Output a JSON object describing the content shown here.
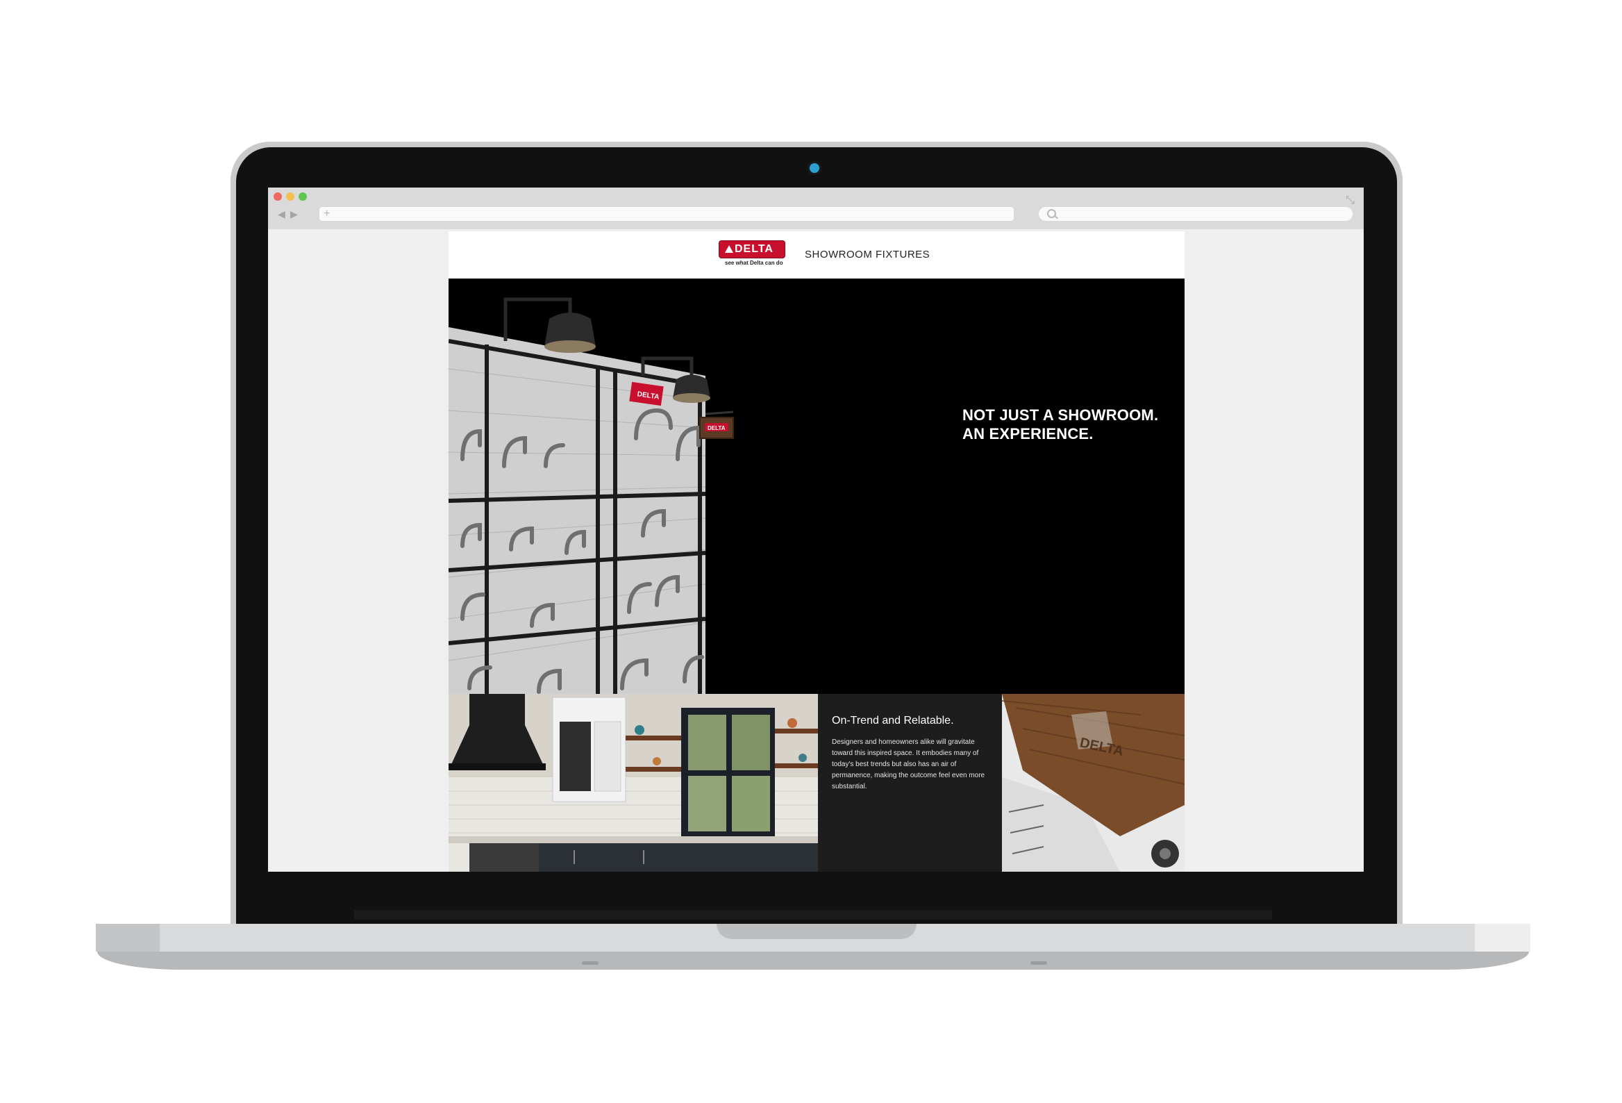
{
  "browser": {
    "window_controls": [
      "close",
      "minimize",
      "maximize"
    ],
    "back_icon": "back-arrow-icon",
    "forward_icon": "forward-arrow-icon",
    "new_tab_symbol": "+",
    "url": "",
    "search_value": ""
  },
  "header": {
    "logo_word": "DELTA",
    "logo_tagline": "see what Delta can do",
    "title": "SHOWROOM FIXTURES"
  },
  "hero": {
    "headline_line1": "NOT JUST A SHOWROOM.",
    "headline_line2": "AN EXPERIENCE.",
    "sign_text": "DELTA"
  },
  "feature": {
    "title": "On-Trend and Relatable.",
    "body": "Designers and homeowners alike will gravitate toward this inspired space. It embodies many of today's best trends but also has an air of permanence, making the outcome feel even more substantial."
  },
  "wood_panel": {
    "engraved_text": "DELTA"
  },
  "colors": {
    "brand_red": "#c8102e",
    "hero_background": "#000000",
    "panel_background": "#1d1d1d",
    "window_close": "#ee6a5e",
    "window_minimize": "#f5bf4f",
    "window_maximize": "#61c554"
  }
}
